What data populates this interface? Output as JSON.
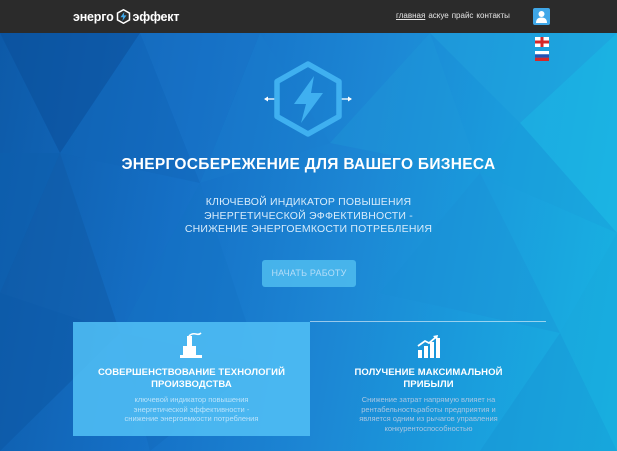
{
  "colors": {
    "topbar": "#2b2b2b",
    "accent": "#3fa7e8",
    "hero_bg_left": "#0d5aa8",
    "hero_bg_right": "#18b4e2",
    "cta_bg": "#4fbdf0",
    "feature_highlight": "#50bef5"
  },
  "header": {
    "logo_left": "энерго",
    "logo_right": "эффект",
    "logo_icon": "lightning-hexagon-icon",
    "nav": [
      {
        "label": "главная",
        "active": true
      },
      {
        "label": "аскуе",
        "active": false
      },
      {
        "label": "прайс",
        "active": false
      },
      {
        "label": "контакты",
        "active": false
      }
    ],
    "user_icon": "user-icon"
  },
  "languages": [
    {
      "icon": "flag-england-icon"
    },
    {
      "icon": "flag-russia-icon"
    }
  ],
  "hero": {
    "icon": "lightning-hexagon-icon",
    "headline": "ЭНЕРГОСБЕРЕЖЕНИЕ ДЛЯ ВАШЕГО БИЗНЕСА",
    "subtitle_lines": [
      "КЛЮЧЕВОЙ ИНДИКАТОР ПОВЫШЕНИЯ",
      "ЭНЕРГЕТИЧЕСКОЙ ЭФФЕКТИВНОСТИ -",
      "СНИЖЕНИЕ ЭНЕРГОЕМКОСТИ ПОТРЕБЛЕНИЯ"
    ],
    "cta_label": "НАЧАТЬ РАБОТУ"
  },
  "features": [
    {
      "icon": "factory-icon",
      "title_lines": [
        "СОВЕРШЕНСТВОВАНИЕ ТЕХНОЛОГИЙ",
        "ПРОИЗВОДСТВА"
      ],
      "desc_lines": [
        "ключевой индикатор повышения",
        "энергетической эффективности -",
        "снижение энергоемкости потребления"
      ]
    },
    {
      "icon": "growth-chart-icon",
      "title_lines": [
        "ПОЛУЧЕНИЕ МАКСИМАЛЬНОЙ",
        "ПРИБЫЛИ"
      ],
      "desc_lines": [
        "Снижение затрат напрямую влияет на",
        "рентабельностьработы предприятия и",
        "является одним из рычагов управления",
        "конкурентоспособностью"
      ]
    }
  ]
}
